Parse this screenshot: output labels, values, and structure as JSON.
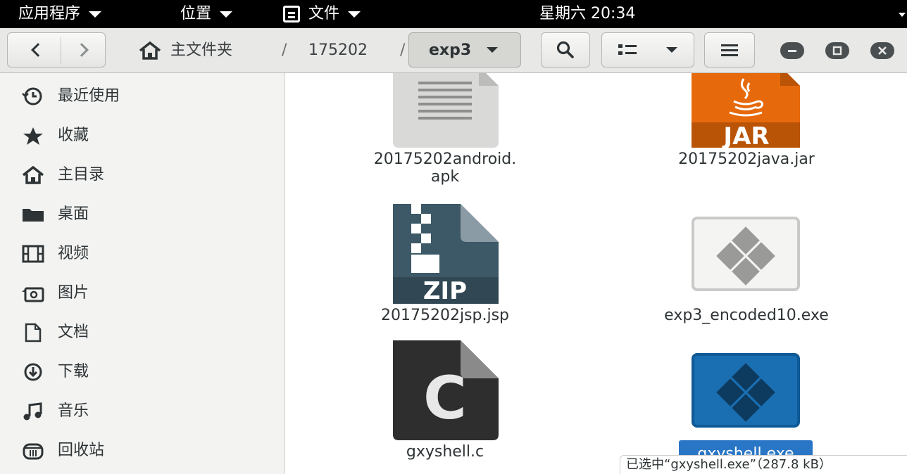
{
  "topbar": {
    "apps_label": "应用程序",
    "places_label": "位置",
    "files_label": "文件",
    "clock": "星期六 20:34"
  },
  "header": {
    "breadcrumb": {
      "home_label": "主文件夹",
      "sep": "/",
      "folder": "175202",
      "current": "exp3"
    }
  },
  "sidebar": {
    "items": [
      {
        "label": "最近使用",
        "icon": "clock-icon"
      },
      {
        "label": "收藏",
        "icon": "star-icon"
      },
      {
        "label": "主目录",
        "icon": "home-icon"
      },
      {
        "label": "桌面",
        "icon": "folder-icon"
      },
      {
        "label": "视频",
        "icon": "film-icon"
      },
      {
        "label": "图片",
        "icon": "camera-icon"
      },
      {
        "label": "文档",
        "icon": "document-icon"
      },
      {
        "label": "下载",
        "icon": "download-icon"
      },
      {
        "label": "音乐",
        "icon": "music-icon"
      },
      {
        "label": "回收站",
        "icon": "trash-icon"
      }
    ]
  },
  "files": [
    {
      "name_line1": "20175202android.",
      "name_line2": "apk",
      "icon": "text-file-icon"
    },
    {
      "name": "20175202java.jar",
      "icon": "jar-icon",
      "badge": "JAR"
    },
    {
      "name": "20175202jsp.jsp",
      "icon": "zip-icon",
      "badge": "ZIP"
    },
    {
      "name": "exp3_encoded10.exe",
      "icon": "exe-icon"
    },
    {
      "name": "gxyshell.c",
      "icon": "c-source-icon",
      "badge": "C"
    },
    {
      "name": "gxyshell.exe",
      "icon": "exe-selected-icon",
      "selected": true
    }
  ],
  "status": {
    "text": "已选中“gxyshell.exe”（287.8 kB）"
  },
  "colors": {
    "accent": "#2a76c6",
    "jar_orange": "#e66a0c",
    "zip_slate": "#3d5866"
  }
}
